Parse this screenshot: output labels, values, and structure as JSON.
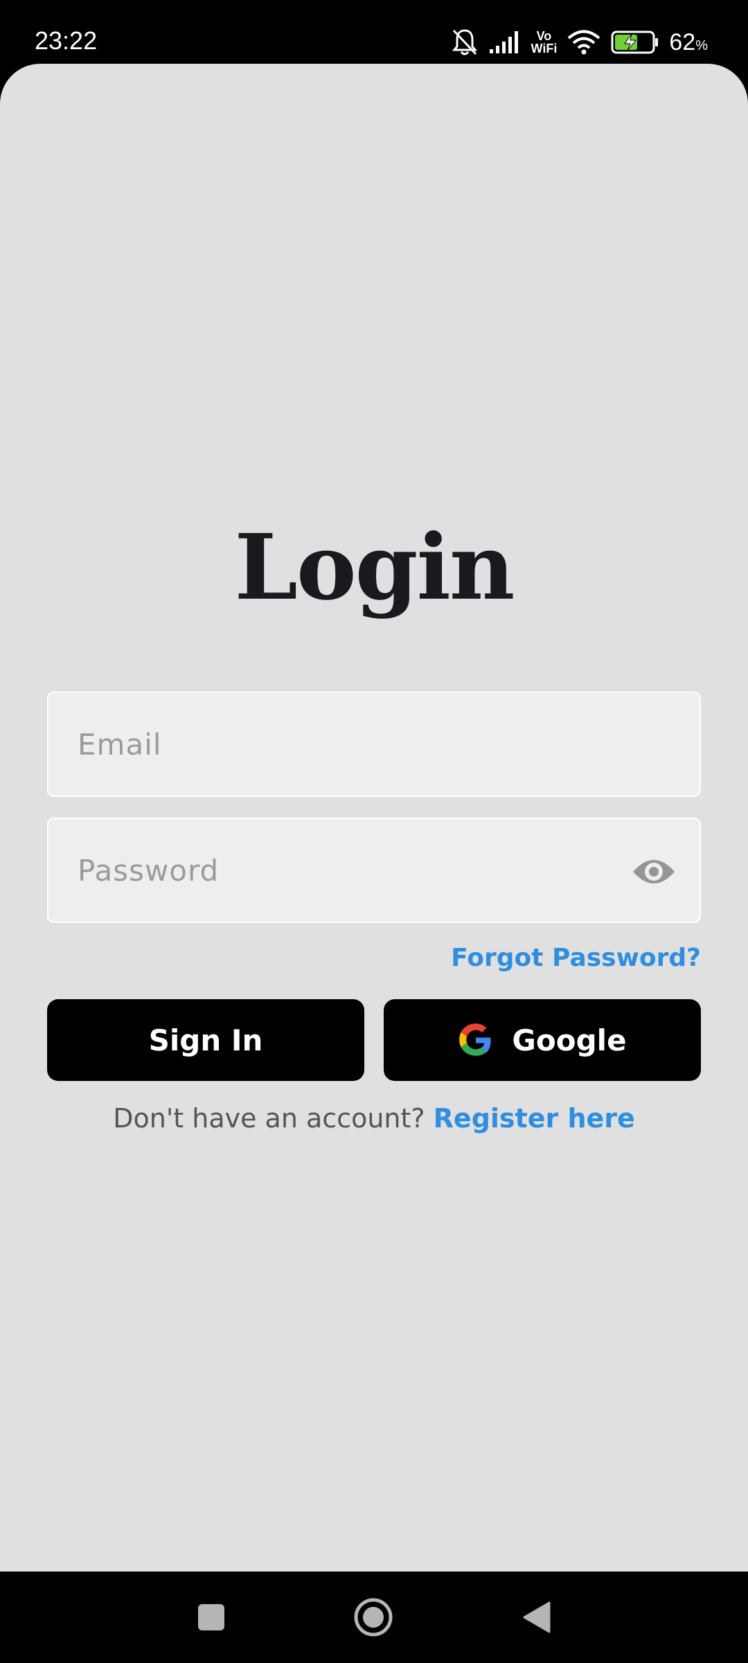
{
  "status_bar": {
    "time": "23:22",
    "vowifi_top": "Vo",
    "vowifi_bottom": "WiFi",
    "battery_percent": "62",
    "battery_unit": "%"
  },
  "login": {
    "title": "Login",
    "email_placeholder": "Email",
    "password_placeholder": "Password",
    "forgot_password": "Forgot Password?",
    "sign_in_label": "Sign In",
    "google_label": "Google",
    "no_account_text": "Don't have an account?",
    "register_label": "Register here"
  },
  "icons": {
    "mute": "bell-off-icon",
    "signal": "signal-icon",
    "wifi": "wifi-icon",
    "battery": "battery-charging-icon",
    "eye": "eye-icon",
    "google": "google-icon",
    "nav_recents": "square-icon",
    "nav_home": "circle-icon",
    "nav_back": "triangle-back-icon"
  },
  "colors": {
    "background": "#e0e0e0",
    "link": "#2f8ee0",
    "button": "#000000",
    "title": "#1a1a1e"
  }
}
